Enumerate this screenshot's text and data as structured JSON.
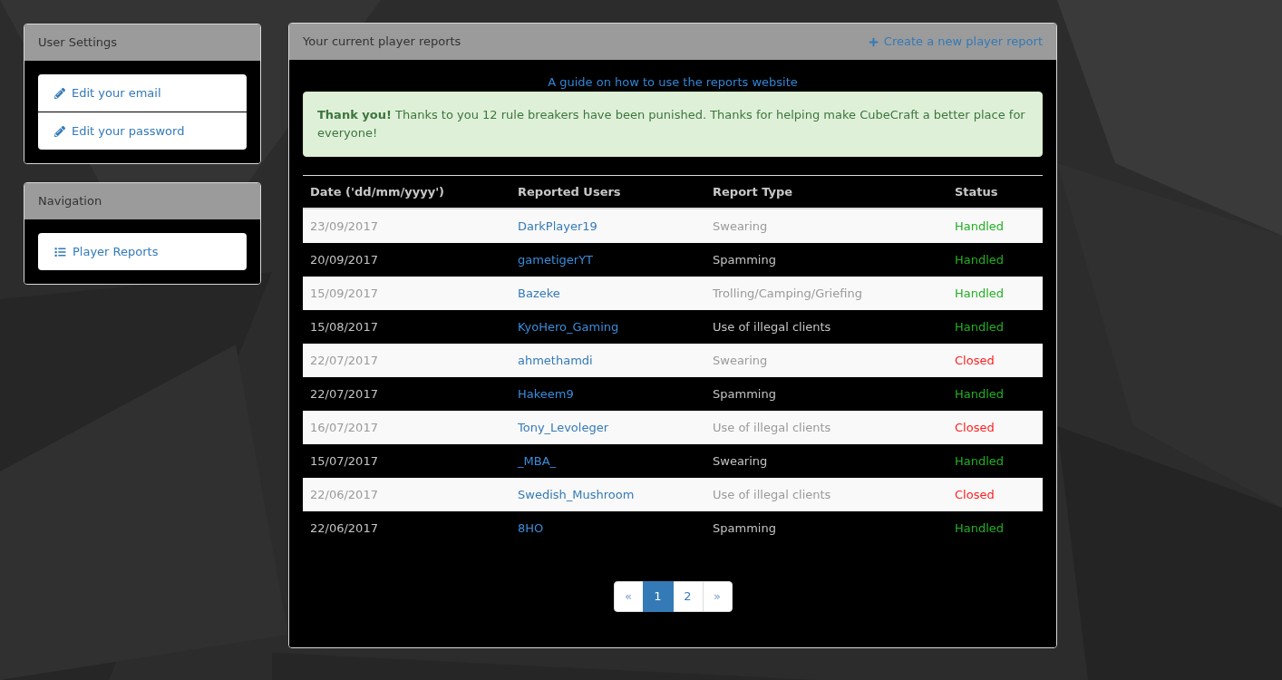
{
  "sidebar": [
    {
      "title": "User Settings",
      "items": [
        {
          "kind": "edit",
          "label": "Edit your email"
        },
        {
          "kind": "edit",
          "label": "Edit your password"
        }
      ]
    },
    {
      "title": "Navigation",
      "items": [
        {
          "kind": "list",
          "label": "Player Reports"
        }
      ]
    }
  ],
  "reports_panel": {
    "title": "Your current player reports",
    "create_link": "Create a new player report",
    "guide_link": "A guide on how to use the reports website",
    "alert": "**Thank you!** Thanks to you 12 rule breakers have been punished. Thanks for helping make CubeCraft a better place for everyone!",
    "table": {
      "columns": [
        "Date ('dd/mm/yyyy')",
        "Reported Users",
        "Report Type",
        "Status"
      ],
      "rows": [
        {
          "date": "23/09/2017",
          "user": "DarkPlayer19",
          "type": "Swearing",
          "status": {
            "text": "Handled",
            "color": "#22b022"
          }
        },
        {
          "date": "20/09/2017",
          "user": "gametigerYT",
          "type": "Spamming",
          "status": {
            "text": "Handled",
            "color": "#22b022"
          }
        },
        {
          "date": "15/09/2017",
          "user": "Bazeke",
          "type": "Trolling/Camping/Griefing",
          "status": {
            "text": "Handled",
            "color": "#22b022"
          }
        },
        {
          "date": "15/08/2017",
          "user": "KyoHero_Gaming",
          "type": "Use of illegal clients",
          "status": {
            "text": "Handled",
            "color": "#22b022"
          }
        },
        {
          "date": "22/07/2017",
          "user": "ahmethamdi",
          "type": "Swearing",
          "status": {
            "text": "Closed",
            "color": "#ff2020"
          }
        },
        {
          "date": "22/07/2017",
          "user": "Hakeem9",
          "type": "Spamming",
          "status": {
            "text": "Handled",
            "color": "#22b022"
          }
        },
        {
          "date": "16/07/2017",
          "user": "Tony_Levoleger",
          "type": "Use of illegal clients",
          "status": {
            "text": "Closed",
            "color": "#ff2020"
          }
        },
        {
          "date": "15/07/2017",
          "user": "_MBA_",
          "type": "Swearing",
          "status": {
            "text": "Handled",
            "color": "#22b022"
          }
        },
        {
          "date": "22/06/2017",
          "user": "Swedish_Mushroom",
          "type": "Use of illegal clients",
          "status": {
            "text": "Closed",
            "color": "#ff2020"
          }
        },
        {
          "date": "22/06/2017",
          "user": "8HO",
          "type": "Spamming",
          "status": {
            "text": "Handled",
            "color": "#22b022"
          }
        }
      ]
    },
    "pagination": [
      {
        "label": "«",
        "selected": false
      },
      {
        "label": "1",
        "selected": true
      },
      {
        "label": "2",
        "selected": false
      },
      {
        "label": "»",
        "selected": false
      }
    ]
  }
}
